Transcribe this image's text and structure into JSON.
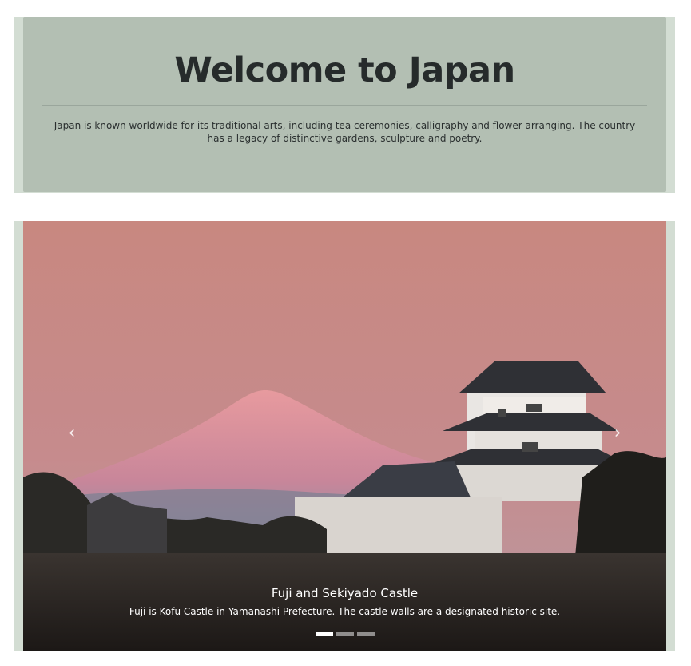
{
  "hero": {
    "title": "Welcome to Japan",
    "lead": "Japan is known worldwide for its traditional arts, including tea ceremonies, calligraphy and flower arranging. The country has a legacy of distinctive gardens, sculpture and poetry."
  },
  "carousel": {
    "prev_icon": "chevron-left-icon",
    "next_icon": "chevron-right-icon",
    "active_index": 0,
    "slides": [
      {
        "title": "Fuji and Sekiyado Castle",
        "caption": "Fuji is Kofu Castle in Yamanashi Prefecture. The castle walls are a designated historic site."
      },
      {
        "title": "",
        "caption": ""
      },
      {
        "title": "",
        "caption": ""
      }
    ]
  },
  "colors": {
    "page_bg": "#ffffff",
    "frame": "#d3ddd3",
    "jumbotron_bg": "#b3bfb3",
    "title_text": "#262b2b",
    "sky_top": "#c88880",
    "mountain_snow": "#e79a9e"
  }
}
